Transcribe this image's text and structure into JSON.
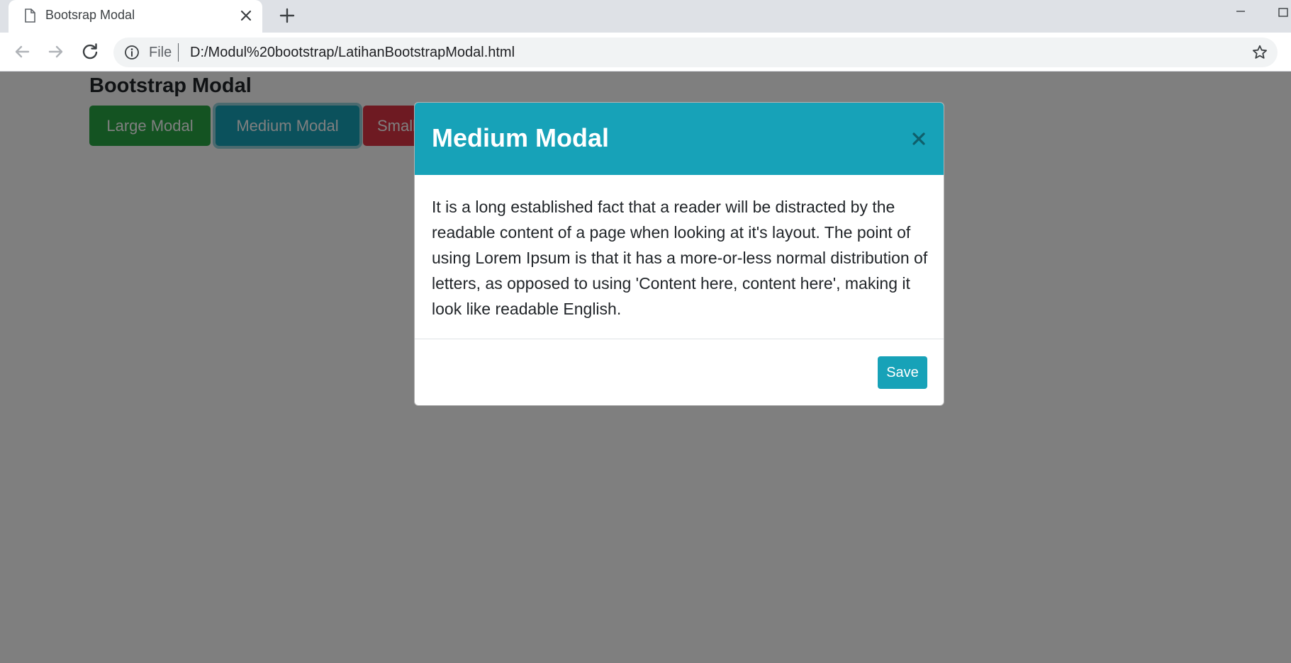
{
  "browser": {
    "tab_title": "Bootsrap Modal",
    "scheme_label": "File",
    "url": "D:/Modul%20bootstrap/LatihanBootstrapModal.html",
    "icons": [
      "page-icon",
      "close-icon",
      "plus-icon",
      "back-arrow-icon",
      "forward-arrow-icon",
      "reload-icon",
      "info-icon",
      "star-icon",
      "minimize-icon",
      "maximize-icon"
    ]
  },
  "page": {
    "title": "Bootstrap Modal",
    "buttons": {
      "large": "Large Modal",
      "medium": "Medium Modal",
      "small": "Small Modal"
    }
  },
  "modal": {
    "title": "Medium Modal",
    "body": "It is a long established fact that a reader will be distracted by the readable content of a page when looking at it's layout. The point of using Lorem Ipsum is that it has a more-or-less normal distribution of letters, as opposed to using 'Content here, content here', making it look like readable English.",
    "save_label": "Save"
  },
  "colors": {
    "success": "#28a745",
    "info": "#17a2b8",
    "danger": "#dc3545",
    "backdrop": "rgba(0,0,0,0.5)"
  }
}
